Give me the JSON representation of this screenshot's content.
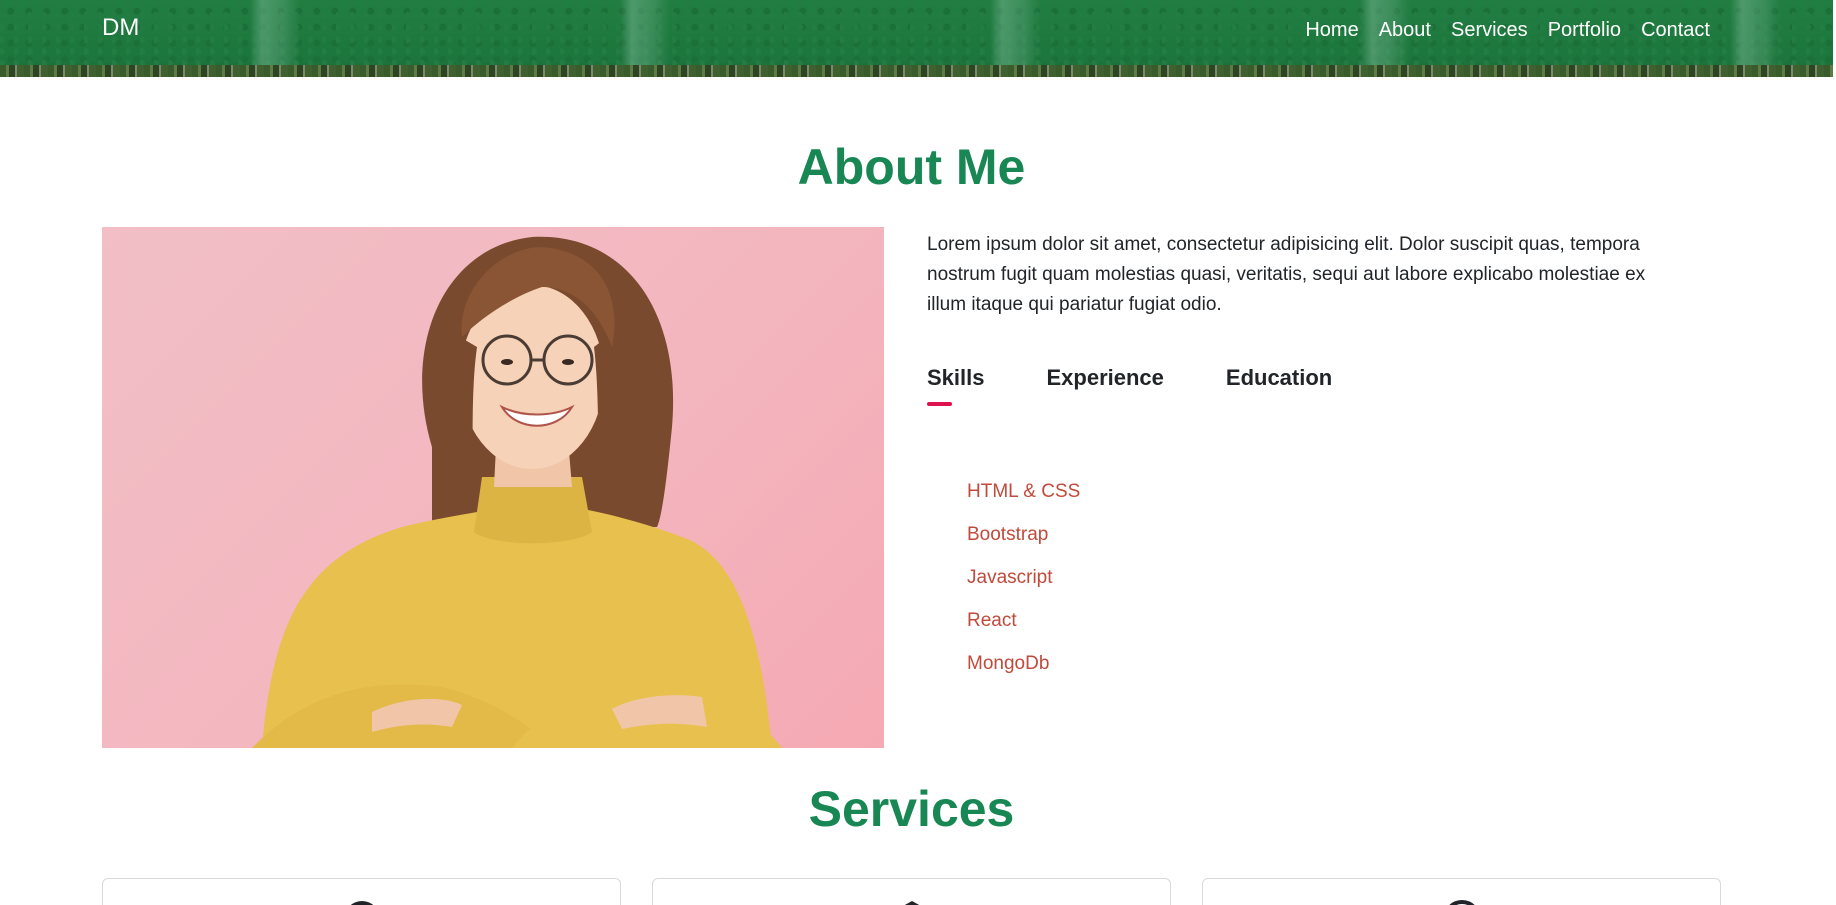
{
  "navbar": {
    "brand": "DM",
    "links": [
      "Home",
      "About",
      "Services",
      "Portfolio",
      "Contact"
    ]
  },
  "about": {
    "title": "About Me",
    "paragraph": "Lorem ipsum dolor sit amet, consectetur adipisicing elit. Dolor suscipit quas, tempora nostrum fugit quam molestias quasi, veritatis, sequi aut labore explicabo molestiae ex illum itaque qui pariatur fugiat odio.",
    "tabs": [
      "Skills",
      "Experience",
      "Education"
    ],
    "active_tab": "Skills",
    "skills": [
      "HTML & CSS",
      "Bootstrap",
      "Javascript",
      "React",
      "MongoDb"
    ]
  },
  "services": {
    "title": "Services",
    "cards": [
      {
        "icon": "code-icon"
      },
      {
        "icon": "layers-icon"
      },
      {
        "icon": "globe-icon"
      }
    ]
  },
  "colors": {
    "accent": "#198754",
    "tab_underline": "#e0114f",
    "skill_text": "#c14a3b"
  }
}
